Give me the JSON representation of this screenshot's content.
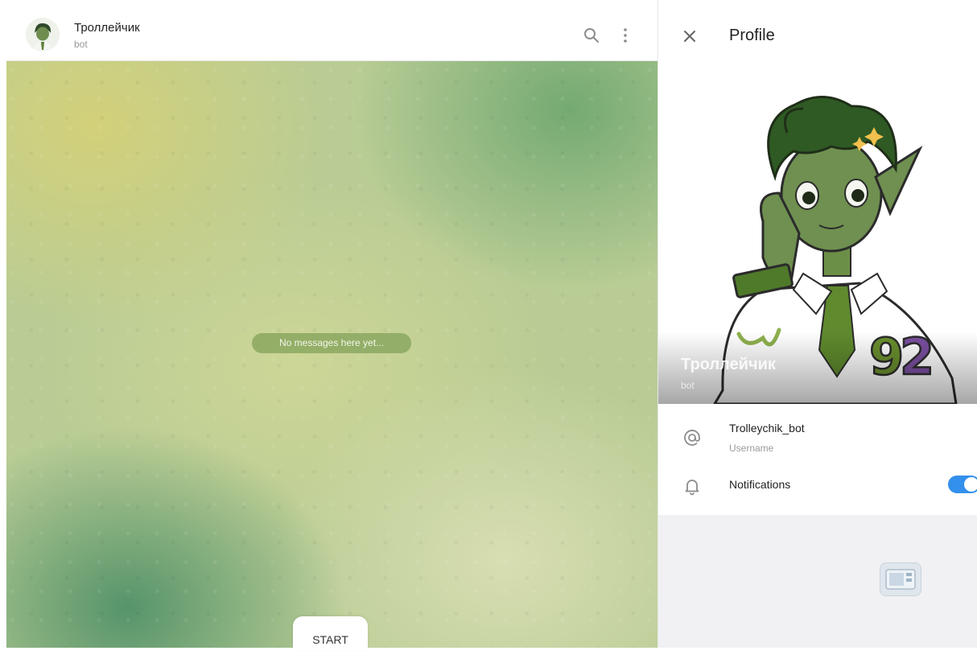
{
  "chat": {
    "title": "Троллейчик",
    "subtitle": "bot",
    "empty_text": "No messages here yet...",
    "start_label": "START"
  },
  "profile": {
    "title": "Profile",
    "photo_name": "Троллейчик",
    "photo_sub": "bot",
    "username_value": "Trolleychik_bot",
    "username_label": "Username",
    "notifications_label": "Notifications",
    "notifications_on": true
  },
  "icons": [
    "search-icon",
    "more-vertical-icon",
    "close-icon",
    "at-icon",
    "bell-icon",
    "media-icon"
  ],
  "colors": {
    "accent": "#3390ec",
    "pill_bg": "#82a258",
    "chat_bg_green": "#70a870",
    "chat_bg_yellow": "#d4d178"
  }
}
